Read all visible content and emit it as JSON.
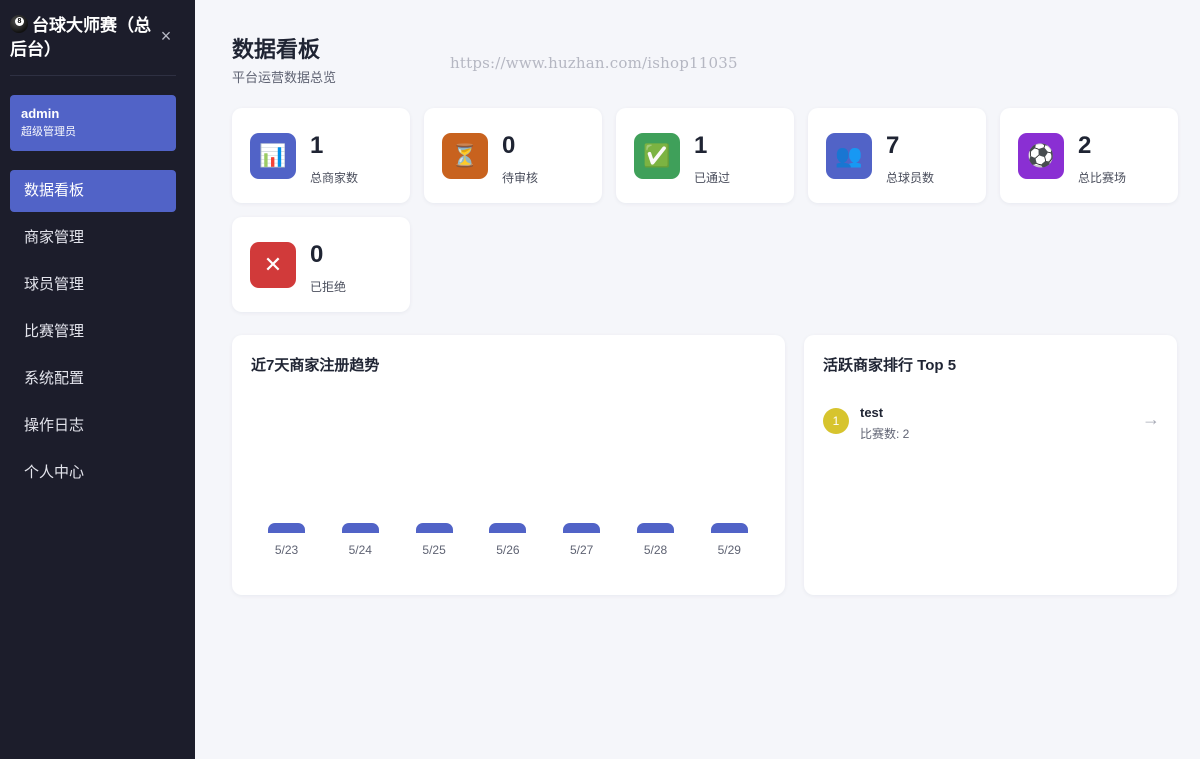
{
  "sidebar": {
    "brand_title": "台球大师赛（总后台）",
    "brand_icon": "8-ball-icon",
    "close_icon": "×",
    "user": {
      "name": "admin",
      "role": "超级管理员"
    },
    "nav": [
      {
        "label": "数据看板",
        "active": true
      },
      {
        "label": "商家管理",
        "active": false
      },
      {
        "label": "球员管理",
        "active": false
      },
      {
        "label": "比赛管理",
        "active": false
      },
      {
        "label": "系统配置",
        "active": false
      },
      {
        "label": "操作日志",
        "active": false
      },
      {
        "label": "个人中心",
        "active": false
      }
    ]
  },
  "header": {
    "title": "数据看板",
    "subtitle": "平台运营数据总览",
    "watermark": "https://www.huzhan.com/ishop11035"
  },
  "stats": [
    {
      "value": "1",
      "label": "总商家数",
      "icon": "📊",
      "icon_name": "bar-chart-icon",
      "color": "#5163c7"
    },
    {
      "value": "0",
      "label": "待审核",
      "icon": "⏳",
      "icon_name": "hourglass-icon",
      "color": "#c8621e"
    },
    {
      "value": "1",
      "label": "已通过",
      "icon": "✅",
      "icon_name": "check-icon",
      "color": "#3fa05a"
    },
    {
      "value": "7",
      "label": "总球员数",
      "icon": "👥",
      "icon_name": "users-icon",
      "color": "#5163c7"
    },
    {
      "value": "2",
      "label": "总比赛场",
      "icon": "⚽",
      "icon_name": "soccer-ball-icon",
      "color": "#8a2fd3"
    },
    {
      "value": "0",
      "label": "已拒绝",
      "icon": "✕",
      "icon_name": "cross-icon",
      "color": "#d13a3a"
    }
  ],
  "trend": {
    "title": "近7天商家注册趋势",
    "chart_data": {
      "type": "bar",
      "categories": [
        "5/23",
        "5/24",
        "5/25",
        "5/26",
        "5/27",
        "5/28",
        "5/29"
      ],
      "values": [
        0,
        0,
        0,
        0,
        0,
        0,
        0
      ],
      "title": "近7天商家注册趋势",
      "xlabel": "",
      "ylabel": ""
    }
  },
  "ranking": {
    "title": "活跃商家排行 Top 5",
    "items": [
      {
        "rank": "1",
        "name": "test",
        "sub": "比赛数: 2",
        "arrow": "→"
      }
    ]
  }
}
